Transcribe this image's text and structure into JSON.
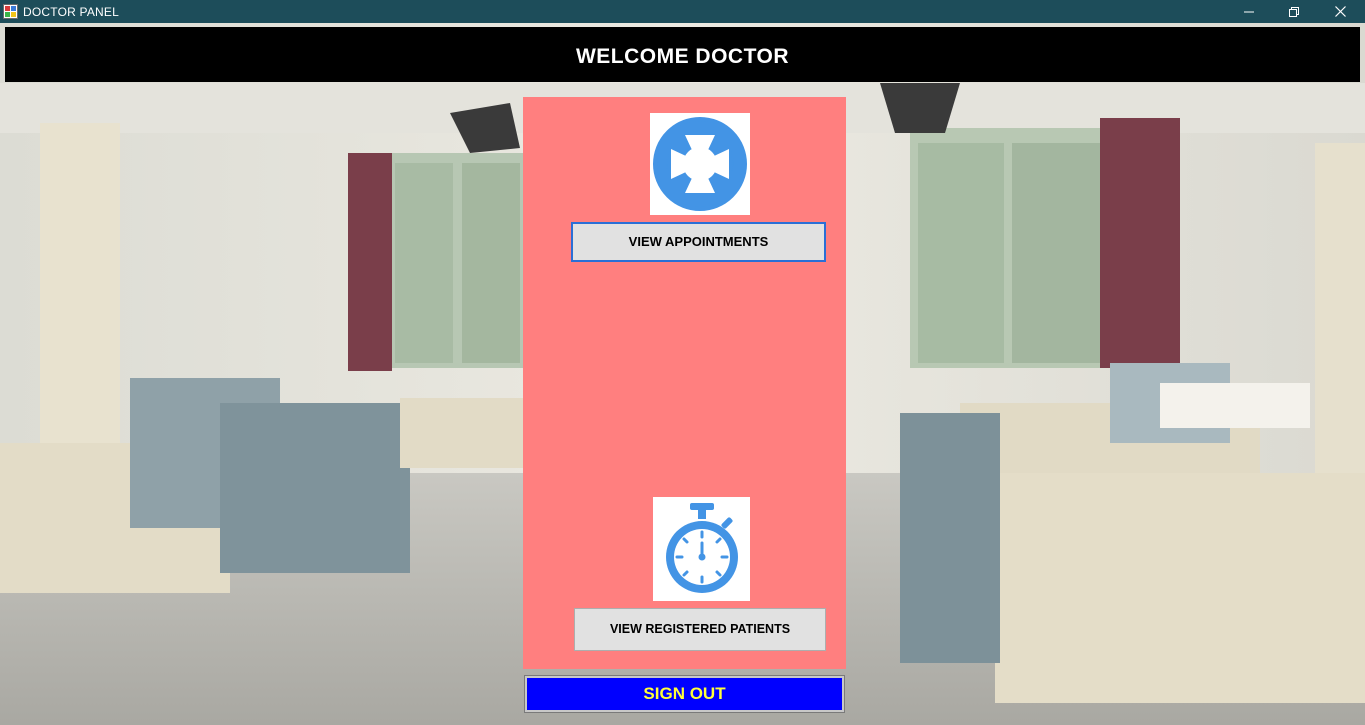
{
  "window": {
    "title": "DOCTOR PANEL",
    "controls": [
      "minimize",
      "restore",
      "close"
    ]
  },
  "header": {
    "title": "WELCOME DOCTOR"
  },
  "panel": {
    "appointments_icon": "lifebuoy-icon",
    "appointments_button": "VIEW APPOINTMENTS",
    "patients_icon": "stopwatch-icon",
    "patients_button": "VIEW REGISTERED PATIENTS"
  },
  "footer": {
    "signout_button": "SIGN OUT"
  },
  "colors": {
    "titlebar": "#1d4d5a",
    "header_bg": "#000000",
    "panel_bg": "#ff7f7f",
    "icon_blue": "#4394e5",
    "signout_bg": "#0000ff",
    "signout_text": "#ffff3a",
    "focus_border": "#2a6fd6"
  }
}
